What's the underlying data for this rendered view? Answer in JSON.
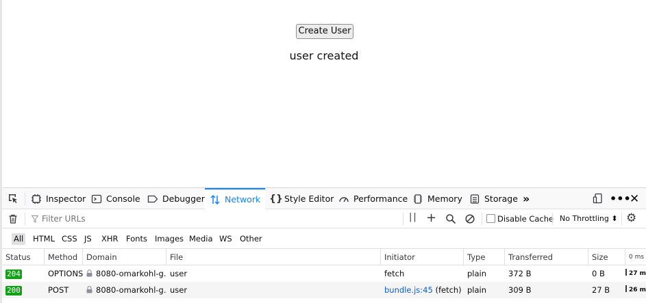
{
  "page": {
    "button_label": "Create User",
    "message": "user created"
  },
  "devtools": {
    "tabs": [
      {
        "label": "Inspector",
        "icon": "inspector-icon"
      },
      {
        "label": "Console",
        "icon": "console-icon"
      },
      {
        "label": "Debugger",
        "icon": "debugger-icon"
      },
      {
        "label": "Network",
        "icon": "network-icon",
        "selected": true
      },
      {
        "label": "Style Editor",
        "icon": "style-editor-icon"
      },
      {
        "label": "Performance",
        "icon": "performance-icon"
      },
      {
        "label": "Memory",
        "icon": "memory-icon"
      },
      {
        "label": "Storage",
        "icon": "storage-icon"
      }
    ],
    "toolbar": {
      "filter_placeholder": "Filter URLs",
      "disable_cache_label": "Disable Cache",
      "throttling_label": "No Throttling ⬍"
    },
    "type_filters": [
      "All",
      "HTML",
      "CSS",
      "JS",
      "XHR",
      "Fonts",
      "Images",
      "Media",
      "WS",
      "Other"
    ],
    "columns": [
      "Status",
      "Method",
      "Domain",
      "File",
      "Initiator",
      "Type",
      "Transferred",
      "Size",
      "0 ms"
    ],
    "rows": [
      {
        "status": "204",
        "method": "OPTIONS",
        "domain": "8080-omarkohl-g...",
        "file": "user",
        "initiator": "fetch",
        "initiator_link": "",
        "type": "plain",
        "transferred": "372 B",
        "size": "0 B",
        "timing": "27 m"
      },
      {
        "status": "200",
        "method": "POST",
        "domain": "8080-omarkohl-g...",
        "file": "user",
        "initiator": " (fetch)",
        "initiator_link": "bundle.js:45",
        "type": "plain",
        "transferred": "309 B",
        "size": "27 B",
        "timing": "26 m"
      }
    ],
    "colors": {
      "accent": "#0a84ff",
      "status_ok": "#12a117"
    }
  }
}
